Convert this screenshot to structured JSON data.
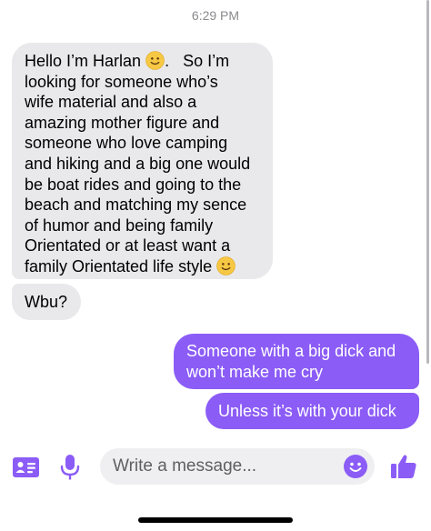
{
  "header": {
    "time": "6:29 PM"
  },
  "messages": {
    "m1": {
      "sender": "incoming",
      "lines": [
        "Hello I’m Harlan",
        "looking for someone who’s",
        "wife material and also a",
        "amazing mother figure and",
        "someone who love camping",
        "and hiking and a big one would",
        "be boat rides and going to the",
        "beach and matching my sence",
        "of humor and being family",
        "Orientated or at least want a",
        "family Orientated life style"
      ],
      "first_line_tail": ".   So I’m",
      "emoji": "slightly-smiling-face-emoji"
    },
    "m2": {
      "sender": "incoming",
      "text": "Wbu?"
    },
    "m3": {
      "sender": "outgoing",
      "lines": [
        "Someone with a big dick and",
        "won’t make me cry"
      ]
    },
    "m4": {
      "sender": "outgoing",
      "text": "Unless it’s with your dick"
    }
  },
  "composer": {
    "placeholder": "Write a message...",
    "icons": [
      "contact-card-icon",
      "microphone-icon",
      "emoji-icon",
      "thumbs-up-icon"
    ]
  },
  "colors": {
    "accent": "#8b5cf6",
    "incoming_bubble": "#e9e9eb",
    "timestamp": "#8a8a8e"
  }
}
